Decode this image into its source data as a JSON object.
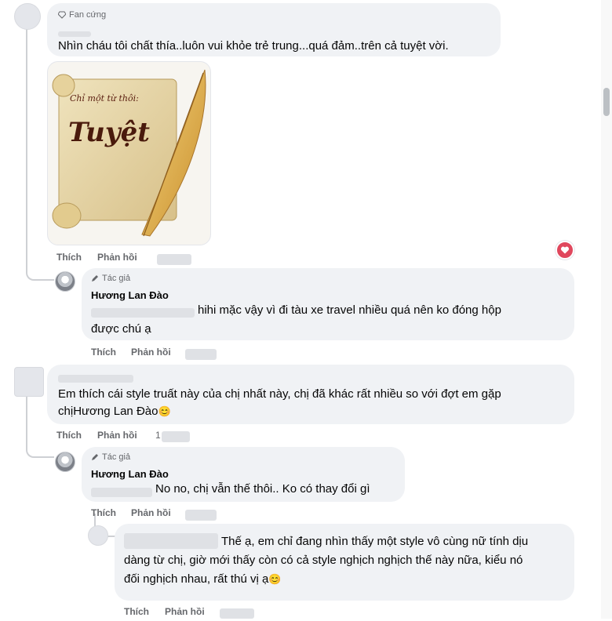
{
  "comments": [
    {
      "badge": "Fan cứng",
      "text": "Nhìn cháu tôi chất thía..luôn vui khỏe trẻ trung...quá đảm..trên cả tuyệt vời.",
      "sticker": {
        "line1": "Chỉ một từ thôi:",
        "line2": "Tuyệt"
      },
      "actions": {
        "like": "Thích",
        "reply": "Phản hồi"
      }
    },
    {
      "badge": "Tác giả",
      "name": "Hương Lan Đào",
      "text_line1": "hihi mặc vậy vì đi tàu xe travel nhiều quá nên ko đóng hộp",
      "text_line2": "được chú ạ",
      "actions": {
        "like": "Thích",
        "reply": "Phản hồi"
      }
    },
    {
      "text_line1": "Em thích cái style truất này của chị nhất này, chị đã khác rất nhiều so với đợt em gặp",
      "text_line2_prefix": "chị",
      "mention": "Hương Lan Đào",
      "emoji": "😊",
      "actions": {
        "like": "Thích",
        "reply": "Phản hồi",
        "time": "1"
      }
    },
    {
      "badge": "Tác giả",
      "name": "Hương Lan Đào",
      "text": "No no, chị vẫn thế thôi.. Ko có thay đổi gì",
      "actions": {
        "like": "Thích",
        "reply": "Phản hồi"
      }
    },
    {
      "text_line1": "Thế ạ, em chỉ đang nhìn thấy một style vô cùng nữ tính dịu",
      "text_line2": "dàng từ chị, giờ mới thấy còn có cả style nghịch nghịch thế này nữa, kiểu nó",
      "text_line3": "đối nghịch nhau, rất thú vị ạ",
      "emoji": "😊",
      "actions": {
        "like": "Thích",
        "reply": "Phản hồi"
      }
    }
  ],
  "icons": {
    "badge_fan": "diamond-icon",
    "badge_author": "pencil-icon",
    "reaction": "heart-icon"
  },
  "colors": {
    "bubble": "#f0f2f5",
    "muted_text": "#65676b",
    "reaction": "#e0475d"
  }
}
